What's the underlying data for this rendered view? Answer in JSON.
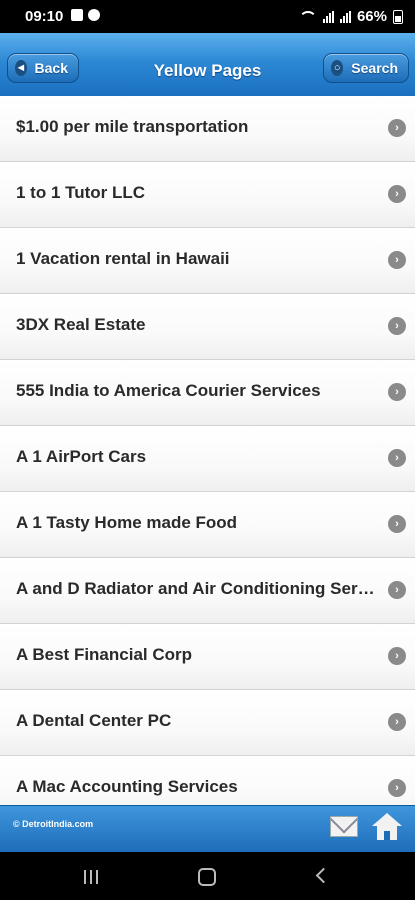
{
  "status_bar": {
    "time": "09:10",
    "battery": "66%"
  },
  "header": {
    "title": "Yellow Pages",
    "back_label": "Back",
    "search_label": "Search"
  },
  "listings": [
    {
      "label": "$1.00 per mile transportation"
    },
    {
      "label": "1 to 1 Tutor LLC"
    },
    {
      "label": "1 Vacation rental in Hawaii"
    },
    {
      "label": "3DX Real Estate"
    },
    {
      "label": "555 India to America Courier Services"
    },
    {
      "label": "A 1 AirPort Cars"
    },
    {
      "label": "A 1 Tasty Home made Food"
    },
    {
      "label": "A and D Radiator and Air Conditioning Services"
    },
    {
      "label": "A Best Financial Corp"
    },
    {
      "label": "A Dental Center PC"
    },
    {
      "label": "A Mac Accounting Services"
    }
  ],
  "footer": {
    "copyright": "© DetroitIndia.com"
  },
  "colors": {
    "header_blue": "#2d88d4",
    "footer_blue": "#1d6cb8"
  },
  "icons": {
    "back": "back-arrow-icon",
    "search": "magnifier-icon",
    "row": "chevron-right-icon",
    "mail": "mail-icon",
    "home": "home-icon"
  }
}
